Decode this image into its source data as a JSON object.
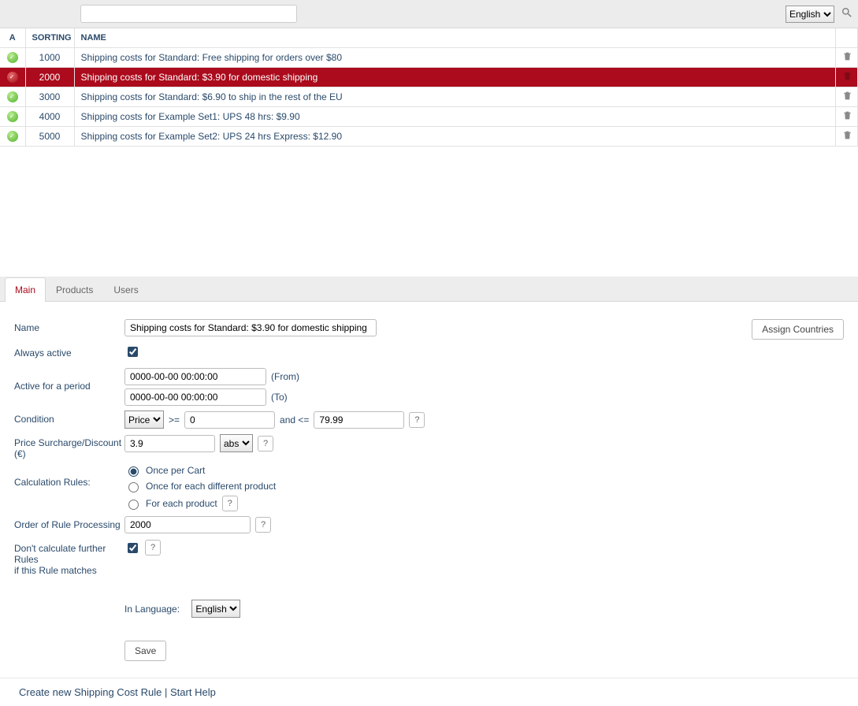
{
  "language_selector": {
    "value": "English",
    "options": [
      "English"
    ]
  },
  "columns": {
    "a": "A",
    "sorting": "SORTING",
    "name": "NAME"
  },
  "rows": [
    {
      "sort": "1000",
      "name": "Shipping costs for Standard: Free shipping for orders over $80",
      "selected": false
    },
    {
      "sort": "2000",
      "name": "Shipping costs for Standard: $3.90 for domestic shipping",
      "selected": true
    },
    {
      "sort": "3000",
      "name": "Shipping costs for Standard: $6.90 to ship in the rest of the EU",
      "selected": false
    },
    {
      "sort": "4000",
      "name": "Shipping costs for Example Set1: UPS 48 hrs: $9.90",
      "selected": false
    },
    {
      "sort": "5000",
      "name": "Shipping costs for Example Set2: UPS 24 hrs Express: $12.90",
      "selected": false
    }
  ],
  "tabs": {
    "main": "Main",
    "products": "Products",
    "users": "Users"
  },
  "form": {
    "name_label": "Name",
    "name_value": "Shipping costs for Standard: $3.90 for domestic shipping",
    "assign_countries": "Assign Countries",
    "always_active_label": "Always active",
    "always_active_checked": true,
    "active_period_label": "Active for a period",
    "from_value": "0000-00-00 00:00:00",
    "from_suffix": "(From)",
    "to_value": "0000-00-00 00:00:00",
    "to_suffix": "(To)",
    "condition_label": "Condition",
    "condition_type": "Price",
    "condition_type_options": [
      "Price"
    ],
    "cond_gte": ">=",
    "cond_gte_val": "0",
    "cond_and": "and <=",
    "cond_lte_val": "79.99",
    "surcharge_label": "Price Surcharge/Discount (€)",
    "surcharge_val": "3.9",
    "surcharge_mode": "abs",
    "surcharge_mode_options": [
      "abs"
    ],
    "calc_label": "Calculation Rules:",
    "calc_once_cart": "Once per Cart",
    "calc_once_product": "Once for each different product",
    "calc_each_product": "For each product",
    "order_label": "Order of Rule Processing",
    "order_val": "2000",
    "stop_label_l1": "Don't calculate further Rules",
    "stop_label_l2": "if this Rule matches",
    "stop_checked": true,
    "in_language_label": "In Language:",
    "in_language_val": "English",
    "in_language_options": [
      "English"
    ],
    "save": "Save"
  },
  "footer": {
    "create": "Create new Shipping Cost Rule",
    "sep": "  |  ",
    "start_help": "Start Help"
  }
}
